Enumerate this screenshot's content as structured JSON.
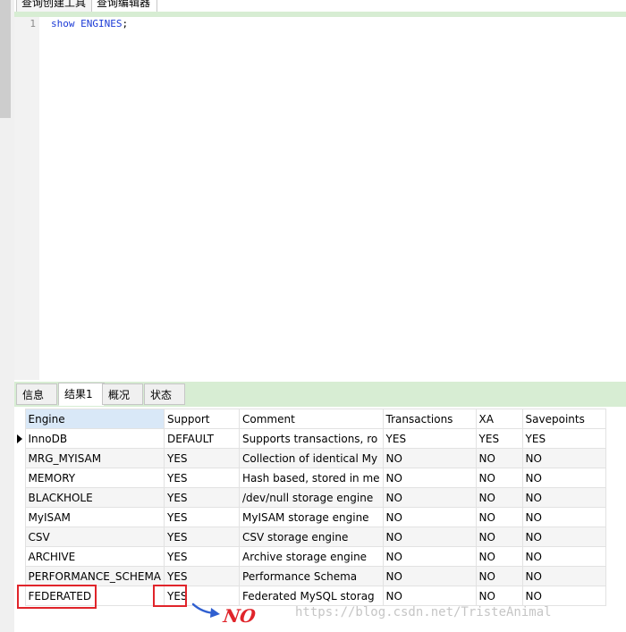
{
  "top_tabs": [
    {
      "label": "查询创建工具",
      "active": false
    },
    {
      "label": "查询编辑器",
      "active": true
    }
  ],
  "editor": {
    "line_number": "1",
    "keyword": "show",
    "identifier": "ENGINES",
    "terminator": ";"
  },
  "result_tabs": [
    {
      "label": "信息",
      "active": false
    },
    {
      "label": "结果1",
      "active": true
    },
    {
      "label": "概况",
      "active": false
    },
    {
      "label": "状态",
      "active": false
    }
  ],
  "grid": {
    "columns": [
      "Engine",
      "Support",
      "Comment",
      "Transactions",
      "XA",
      "Savepoints"
    ],
    "rows": [
      [
        "InnoDB",
        "DEFAULT",
        "Supports transactions, ro",
        "YES",
        "YES",
        "YES"
      ],
      [
        "MRG_MYISAM",
        "YES",
        "Collection of identical My",
        "NO",
        "NO",
        "NO"
      ],
      [
        "MEMORY",
        "YES",
        "Hash based, stored in me",
        "NO",
        "NO",
        "NO"
      ],
      [
        "BLACKHOLE",
        "YES",
        "/dev/null storage engine",
        "NO",
        "NO",
        "NO"
      ],
      [
        "MyISAM",
        "YES",
        "MyISAM storage engine",
        "NO",
        "NO",
        "NO"
      ],
      [
        "CSV",
        "YES",
        "CSV storage engine",
        "NO",
        "NO",
        "NO"
      ],
      [
        "ARCHIVE",
        "YES",
        "Archive storage engine",
        "NO",
        "NO",
        "NO"
      ],
      [
        "PERFORMANCE_SCHEMA",
        "YES",
        "Performance Schema",
        "NO",
        "NO",
        "NO"
      ],
      [
        "FEDERATED",
        "YES",
        "Federated MySQL storag",
        "NO",
        "NO",
        "NO"
      ]
    ]
  },
  "annotation": {
    "note": "NO",
    "color": "#e0242a",
    "arrow_color": "#2f5fd0"
  },
  "watermark": "https://blog.csdn.net/TristeAnimal"
}
